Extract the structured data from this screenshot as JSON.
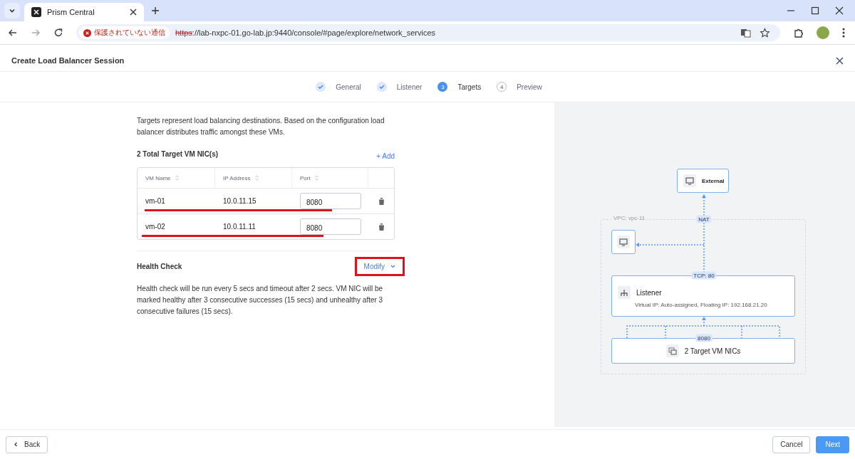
{
  "browser": {
    "tab_title": "Prism Central",
    "security_label": "保護されていない通信",
    "url_scheme": "https",
    "url_rest": "://lab-nxpc-01.go-lab.jp:9440/console/#page/explore/network_services"
  },
  "dialog": {
    "title": "Create Load Balancer Session"
  },
  "steps": [
    {
      "label": "General",
      "done": true,
      "selected": false
    },
    {
      "label": "Listener",
      "done": true,
      "selected": false
    },
    {
      "label": "Targets",
      "done": false,
      "selected": true,
      "number": "3"
    },
    {
      "label": "Preview",
      "done": false,
      "selected": false,
      "number": "4"
    }
  ],
  "intro": "Targets represent load balancing destinations. Based on the configuration load balancer distributes traffic amongst these VMs.",
  "targets": {
    "title": "2 Total Target VM NIC(s)",
    "add_label": "+ Add",
    "columns": [
      "VM Name",
      "IP Address",
      "Port"
    ],
    "rows": [
      {
        "vm_name": "vm-01",
        "ip": "10.0.11.15",
        "port": "8080",
        "underlined": true
      },
      {
        "vm_name": "vm-02",
        "ip": "10.0.11.11",
        "port": "8080",
        "underlined": true
      }
    ]
  },
  "health_check": {
    "title": "Health Check",
    "modify_label": "Modify",
    "highlighted": true,
    "text": "Health check will be run every 5 secs and timeout after 2 secs. VM NIC will be marked healthy after 3 consecutive successes (15 secs) and unhealthy after 3 consecutive failures (15 secs)."
  },
  "diagram": {
    "external": "External",
    "vpc_label": "VPC: vpc-11",
    "nat_label": "NAT",
    "listener_port": "TCP: 80",
    "listener_title": "Listener",
    "listener_detail": "Virtual IP: Auto-assigned, Floating IP: 192.168.21.20",
    "target_port": "8080",
    "targets_label": "2 Target VM NICs"
  },
  "footer": {
    "back": "Back",
    "cancel": "Cancel",
    "next": "Next"
  }
}
